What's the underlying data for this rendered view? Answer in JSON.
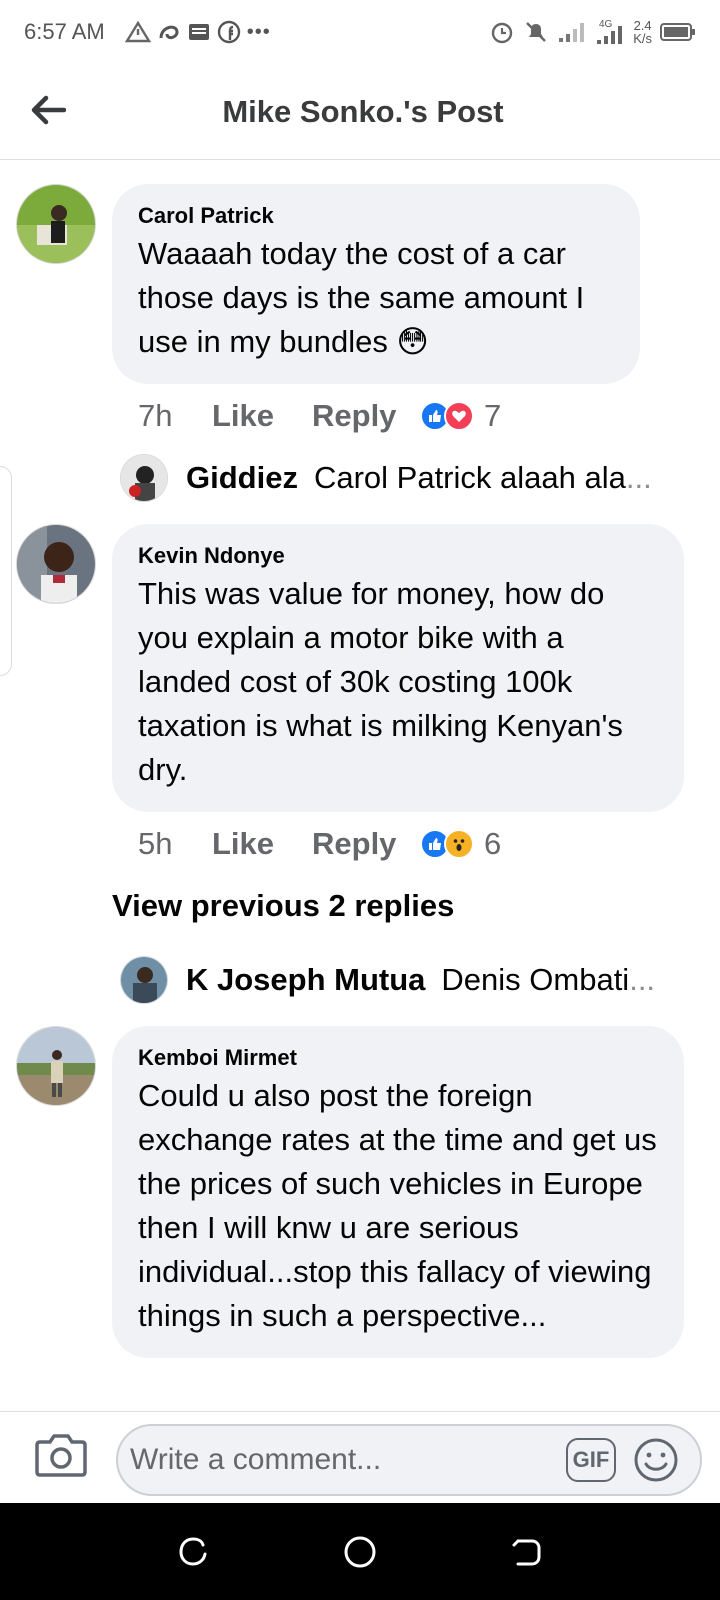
{
  "status_bar": {
    "time": "6:57 AM",
    "more_dots": "•••",
    "network": "4G",
    "speed_value": "2.4",
    "speed_unit": "K/s"
  },
  "header": {
    "title": "Mike Sonko.'s Post"
  },
  "comments": [
    {
      "author": "Carol Patrick",
      "text": "Waaaah  today the cost of a car those days is the same amount I use in my bundles 😳",
      "time": "7h",
      "like_label": "Like",
      "reply_label": "Reply",
      "reactions": [
        "like-icon",
        "love-icon"
      ],
      "reaction_count": "7",
      "reply_preview": {
        "name": "Giddiez",
        "text": "Carol Patrick alaah ala",
        "ellipsis": "..."
      }
    },
    {
      "author": "Kevin Ndonye",
      "text": "This was value for money, how do you explain a motor bike with a landed cost of 30k costing 100k taxation is what is milking Kenyan's dry.",
      "time": "5h",
      "like_label": "Like",
      "reply_label": "Reply",
      "reactions": [
        "like-icon",
        "wow-icon"
      ],
      "reaction_count": "6",
      "view_previous": "View previous 2 replies",
      "reply_preview": {
        "name": "K Joseph Mutua",
        "text": "Denis Ombati",
        "ellipsis": "..."
      }
    },
    {
      "author": "Kemboi Mirmet",
      "text": "Could u also post the foreign exchange rates at the time  and get us the prices of such vehicles in Europe then I will knw u are serious individual...stop this fallacy of viewing things in such a perspective..."
    }
  ],
  "composer": {
    "placeholder": "Write a comment...",
    "gif_label": "GIF"
  },
  "colors": {
    "bubble": "#f0f2f5",
    "like_blue": "#1877f2",
    "love_red": "#f33e58",
    "wow_yellow": "#f7b125",
    "secondary_text": "#65676b"
  }
}
